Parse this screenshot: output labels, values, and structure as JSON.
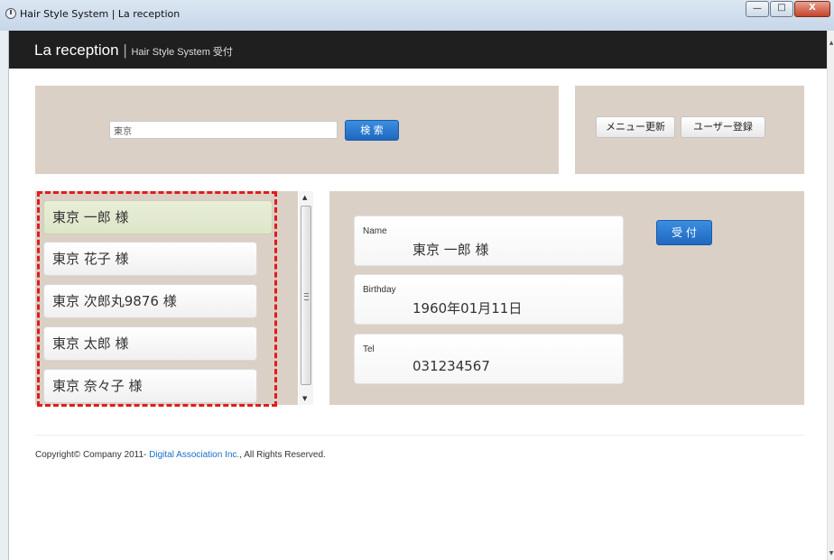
{
  "window": {
    "title": "Hair Style System | La reception",
    "minimize_glyph": "—",
    "maximize_glyph": "□",
    "close_glyph": "X"
  },
  "header": {
    "brand": "La reception",
    "separator": "|",
    "subtitle": "Hair Style System 受付"
  },
  "search": {
    "value": "東京",
    "button_label": "検 索"
  },
  "menu": {
    "update_label": "メニュー更新",
    "register_label": "ユーザー登録"
  },
  "customers": [
    {
      "label": "東京 一郎  様",
      "selected": true
    },
    {
      "label": "東京 花子  様",
      "selected": false
    },
    {
      "label": "東京 次郎丸9876  様",
      "selected": false
    },
    {
      "label": "東京 太郎  様",
      "selected": false
    },
    {
      "label": "東京 奈々子  様",
      "selected": false
    }
  ],
  "detail": {
    "name_label": "Name",
    "name_value": "東京 一郎  様",
    "birthday_label": "Birthday",
    "birthday_value": "1960年01月11日",
    "tel_label": "Tel",
    "tel_value": "031234567",
    "reception_button": "受 付"
  },
  "footer": {
    "prefix": "Copyright© Company 2011- ",
    "link": "Digital Association Inc.",
    "suffix": ", All Rights Reserved."
  },
  "colors": {
    "panel_bg": "#dbd0c6",
    "header_bg": "#1f1f1f",
    "accent_blue": "#1f68c0",
    "selected_item": "#e3ead2",
    "highlight_dash": "#e01c1c"
  }
}
